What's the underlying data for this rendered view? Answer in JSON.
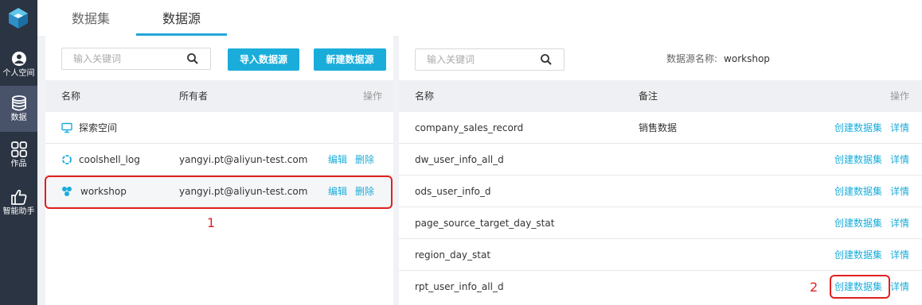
{
  "nav": {
    "items": [
      {
        "label": "个人空间"
      },
      {
        "label": "数据"
      },
      {
        "label": "作品"
      },
      {
        "label": "智能助手"
      }
    ]
  },
  "tabs": [
    {
      "label": "数据集"
    },
    {
      "label": "数据源"
    }
  ],
  "left": {
    "search_placeholder": "输入关键词",
    "import_button": "导入数据源",
    "new_button": "新建数据源",
    "columns": {
      "name": "名称",
      "owner": "所有者",
      "ops": "操作"
    },
    "rows": [
      {
        "name": "探索空间",
        "owner": "",
        "edit": "",
        "delete": ""
      },
      {
        "name": "coolshell_log",
        "owner": "yangyi.pt@aliyun-test.com",
        "edit": "编辑",
        "delete": "删除"
      },
      {
        "name": "workshop",
        "owner": "yangyi.pt@aliyun-test.com",
        "edit": "编辑",
        "delete": "删除"
      }
    ],
    "annotation": "1"
  },
  "right": {
    "search_placeholder": "输入关键词",
    "source_label": "数据源名称:",
    "source_value": "workshop",
    "columns": {
      "name": "名称",
      "note": "备注",
      "ops": "操作"
    },
    "rows": [
      {
        "name": "company_sales_record",
        "note": "销售数据",
        "create": "创建数据集",
        "detail": "详情"
      },
      {
        "name": "dw_user_info_all_d",
        "note": "",
        "create": "创建数据集",
        "detail": "详情"
      },
      {
        "name": "ods_user_info_d",
        "note": "",
        "create": "创建数据集",
        "detail": "详情"
      },
      {
        "name": "page_source_target_day_stat",
        "note": "",
        "create": "创建数据集",
        "detail": "详情"
      },
      {
        "name": "region_day_stat",
        "note": "",
        "create": "创建数据集",
        "detail": "详情"
      },
      {
        "name": "rpt_user_info_all_d",
        "note": "",
        "create": "创建数据集",
        "detail": "详情"
      }
    ],
    "annotation": "2"
  },
  "colors": {
    "accent": "#1aadda",
    "nav_bg": "#2b3442",
    "highlight": "#e02020"
  },
  "icons": [
    "logo-icon",
    "user-icon",
    "database-icon",
    "grid-icon",
    "thumbs-up-icon",
    "search-icon",
    "monitor-icon",
    "circle-icon",
    "cluster-icon"
  ]
}
